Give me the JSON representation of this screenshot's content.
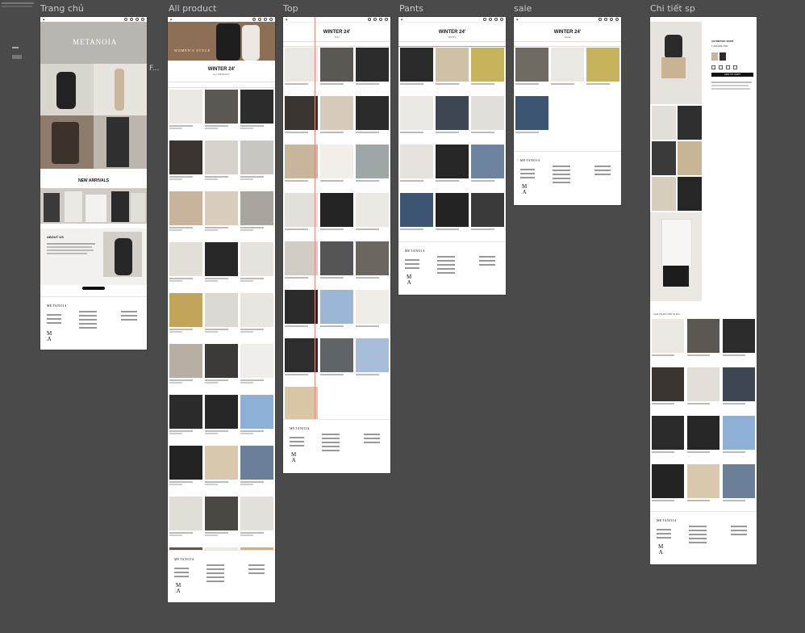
{
  "canvas": {
    "frames": [
      {
        "id": "home",
        "label": "Trang chủ"
      },
      {
        "id": "all",
        "label": "All product"
      },
      {
        "id": "top",
        "label": "Top"
      },
      {
        "id": "pants",
        "label": "Pants"
      },
      {
        "id": "sale",
        "label": "sale"
      },
      {
        "id": "detail",
        "label": "Chi tiết sp"
      }
    ],
    "side_label": "F..."
  },
  "home": {
    "hero_text": "METANOIA",
    "section_title": "NEW ARRIVALS",
    "about_title": "ABOUT US",
    "footer_brand": "METANOIA",
    "footer_logo": "M T A N"
  },
  "all": {
    "hero_text": "WOMEN'S STYLE",
    "page_title": "WINTER 24'",
    "subtitle": "ALL PRODUCT",
    "footer_brand": "METANOIA"
  },
  "top": {
    "page_title": "WINTER 24'",
    "subtitle": "TOP",
    "footer_brand": "METANOIA"
  },
  "pants": {
    "page_title": "WINTER 24'",
    "subtitle": "PANTS",
    "footer_brand": "METANOIA"
  },
  "sale": {
    "page_title": "WINTER 24'",
    "subtitle": "SALE",
    "footer_brand": "METANOIA"
  },
  "detail": {
    "product_name": "ASYMETRIC SKIRT",
    "price": "1,200,000 VND",
    "buy_label": "ADD TO CART",
    "related": "SẢN PHẨM LIÊN QUAN",
    "footer_brand": "METANOIA"
  }
}
